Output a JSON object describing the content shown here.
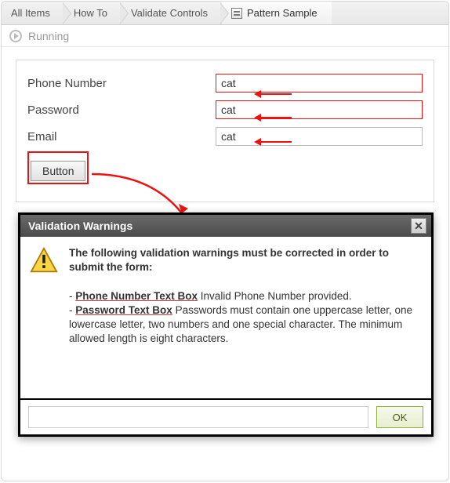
{
  "breadcrumbs": {
    "items": [
      {
        "label": "All Items"
      },
      {
        "label": "How To"
      },
      {
        "label": "Validate Controls"
      },
      {
        "label": "Pattern Sample",
        "selected": true
      }
    ]
  },
  "status": {
    "label": "Running"
  },
  "form": {
    "fields": [
      {
        "label": "Phone Number",
        "value": "cat",
        "error": true
      },
      {
        "label": "Password",
        "value": "cat",
        "error": true
      },
      {
        "label": "Email",
        "value": "cat",
        "error": false
      }
    ],
    "button_label": "Button"
  },
  "dialog": {
    "title": "Validation Warnings",
    "lead": "The following validation warnings must be corrected in order to submit the form:",
    "items": [
      {
        "field": "Phone Number Text Box",
        "message": "Invalid Phone Number provided."
      },
      {
        "field": "Password Text Box",
        "message": "Passwords must contain one uppercase letter, one lowercase letter, two numbers and one special character. The minimum allowed length is eight characters."
      }
    ],
    "ok_label": "OK"
  },
  "colors": {
    "error": "#ee1111",
    "accent": "#8fae3b"
  }
}
